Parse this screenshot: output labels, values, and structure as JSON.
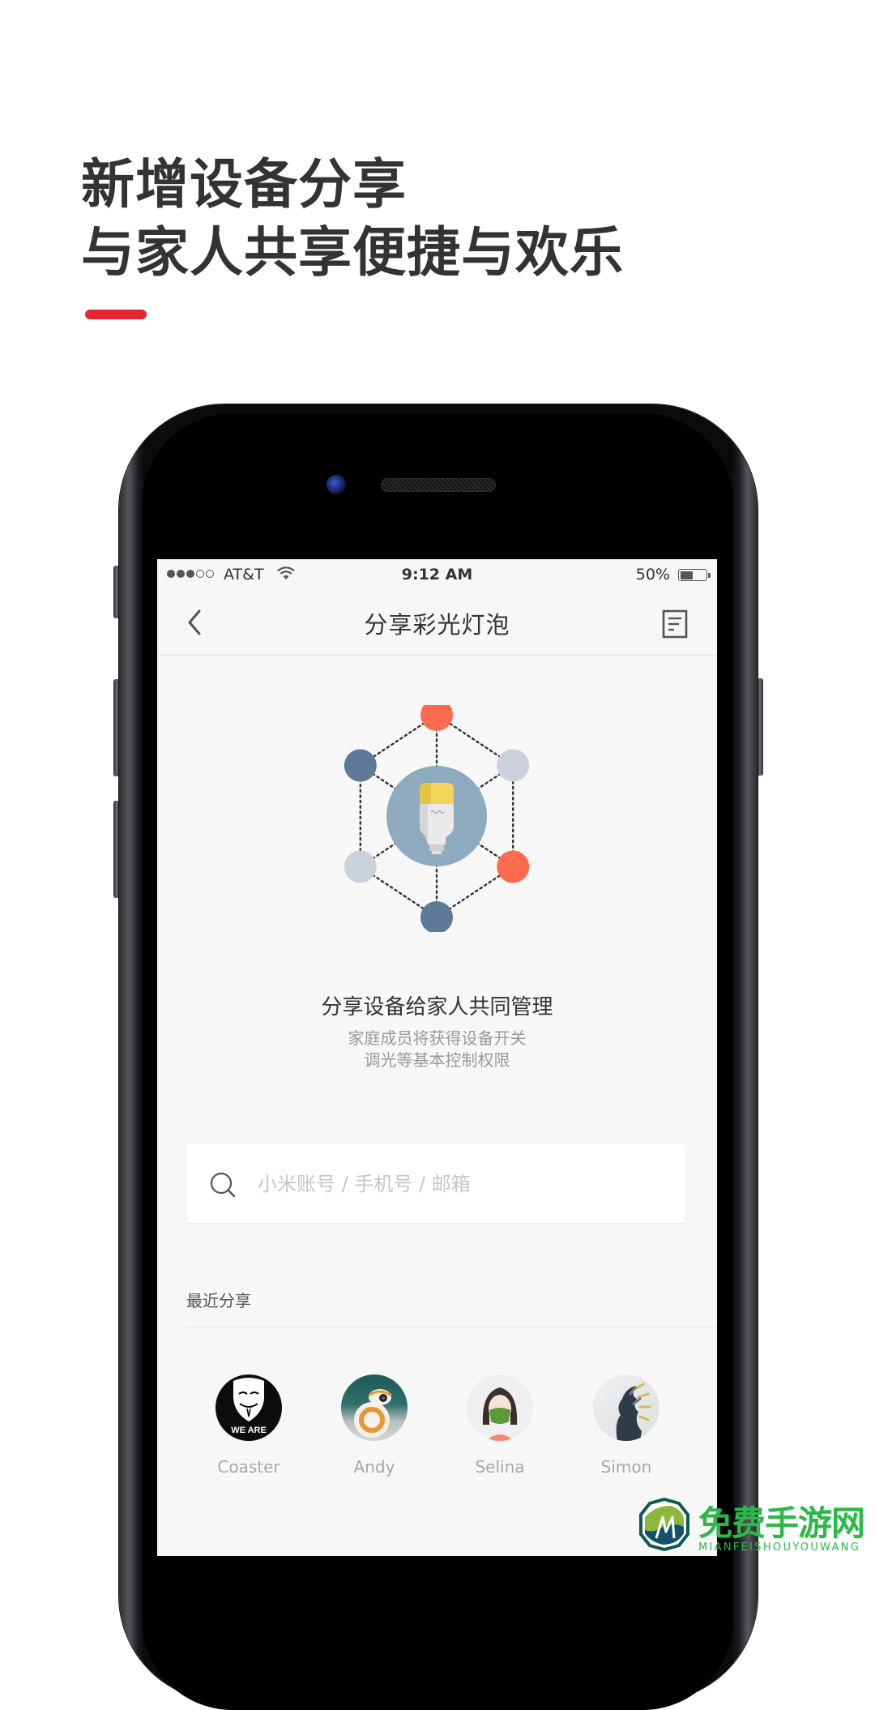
{
  "promo": {
    "headline_line1": "新增设备分享",
    "headline_line2": "与家人共享便捷与欢乐",
    "accent_color": "#E8262F"
  },
  "status_bar": {
    "signal_bars_filled": 3,
    "signal_bars_total": 5,
    "carrier": "AT&T",
    "time": "9:12 AM",
    "battery_percent_label": "50%",
    "battery_level": 0.5
  },
  "nav": {
    "back_icon": "chevron-left-icon",
    "title": "分享彩光灯泡",
    "log_icon": "document-list-icon"
  },
  "illustration": {
    "center_icon": "light-bulb-icon",
    "node_colors": [
      "#FF6B4F",
      "#5E7A96",
      "#C9D1DB",
      "#C9D1DB",
      "#FF6B4F",
      "#5E7A96"
    ],
    "center_color": "#8EAABF"
  },
  "share_info": {
    "headline": "分享设备给家人共同管理",
    "description_line1": "家庭成员将获得设备开关",
    "description_line2": "调光等基本控制权限"
  },
  "search": {
    "icon": "search-icon",
    "value": "",
    "placeholder": "小米账号 / 手机号 / 邮箱"
  },
  "recent": {
    "label": "最近分享",
    "contacts": [
      {
        "name": "Coaster",
        "avatar_caption": "WE ARE"
      },
      {
        "name": "Andy"
      },
      {
        "name": "Selina"
      },
      {
        "name": "Simon"
      }
    ]
  },
  "watermark": {
    "title": "免费手游网",
    "subtitle": "MIANFEISHOUYOUWANG"
  }
}
